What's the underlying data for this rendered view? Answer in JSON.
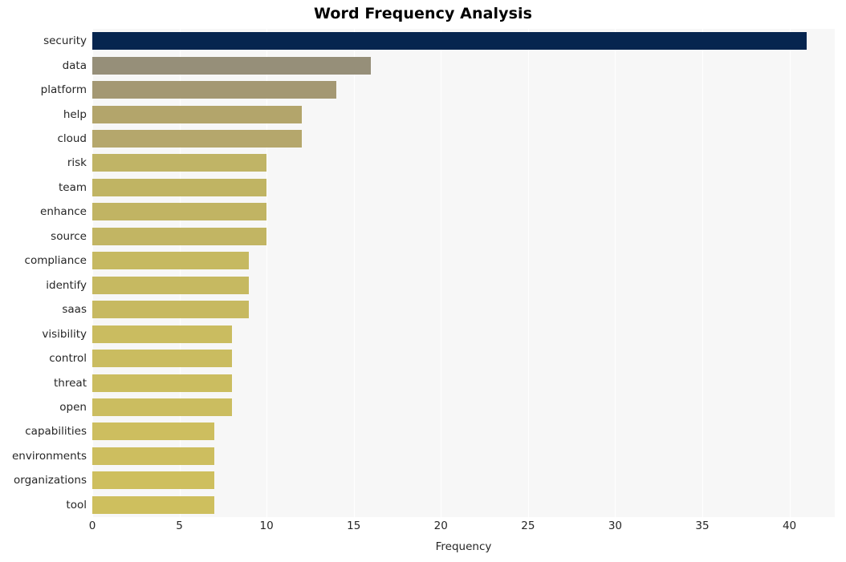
{
  "chart_data": {
    "type": "bar",
    "orientation": "horizontal",
    "title": "Word Frequency Analysis",
    "xlabel": "Frequency",
    "ylabel": "",
    "xlim": [
      0,
      42.6
    ],
    "xticks": [
      0,
      5,
      10,
      15,
      20,
      25,
      30,
      35,
      40
    ],
    "xticklabels": [
      "0",
      "5",
      "10",
      "15",
      "20",
      "25",
      "30",
      "35",
      "40"
    ],
    "grid": "vertical",
    "legend": "none",
    "categories": [
      "security",
      "data",
      "platform",
      "help",
      "cloud",
      "risk",
      "team",
      "enhance",
      "source",
      "compliance",
      "identify",
      "saas",
      "visibility",
      "control",
      "threat",
      "open",
      "capabilities",
      "environments",
      "organizations",
      "tool"
    ],
    "values": [
      41,
      16,
      14,
      12,
      12,
      10,
      10,
      10,
      10,
      9,
      9,
      9,
      8,
      8,
      8,
      8,
      7,
      7,
      7,
      7
    ],
    "bar_colors": [
      "#06254f",
      "#968f79",
      "#a49873",
      "#b3a56b",
      "#b5a76c",
      "#c0b466",
      "#c0b463",
      "#c1b463",
      "#c2b563",
      "#c6b961",
      "#c6b961",
      "#c7b961",
      "#cabc60",
      "#cabc60",
      "#cbbd60",
      "#cbbd60",
      "#cdbe5f",
      "#cdbe5f",
      "#cebf5e",
      "#cebf5e"
    ],
    "plot_background": "#f7f7f7",
    "figure_background": "#ffffff",
    "grid_color": "#ffffff",
    "title_color": "#000000",
    "tick_label_color": "#262626"
  }
}
